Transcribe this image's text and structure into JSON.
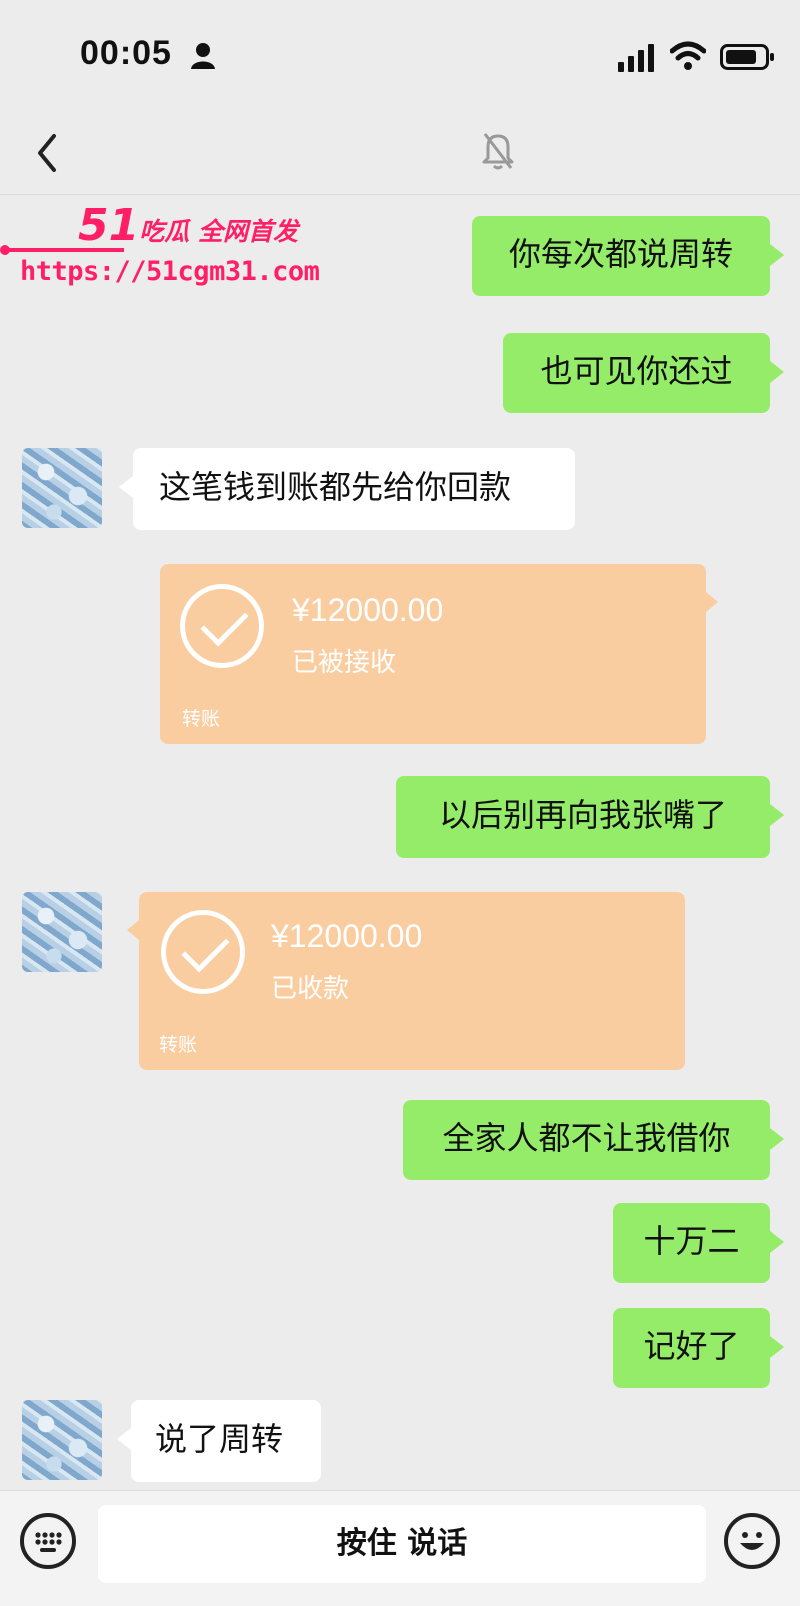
{
  "status_bar": {
    "time": "00:05"
  },
  "watermark": {
    "logo_number": "51",
    "logo_text": "吃瓜 全网首发",
    "url": "https://51cgm31.com"
  },
  "messages": [
    {
      "side": "right",
      "text": "你每次都说周转"
    },
    {
      "side": "right",
      "text": "也可见你还过"
    },
    {
      "side": "left",
      "text": "这笔钱到账都先给你回款"
    },
    {
      "side": "right",
      "type": "transfer",
      "amount": "¥12000.00",
      "status": "已被接收",
      "label": "转账"
    },
    {
      "side": "right",
      "text": "以后别再向我张嘴了"
    },
    {
      "side": "left",
      "type": "transfer",
      "amount": "¥12000.00",
      "status": "已收款",
      "label": "转账"
    },
    {
      "side": "right",
      "text": "全家人都不让我借你"
    },
    {
      "side": "right",
      "text": "十万二"
    },
    {
      "side": "right",
      "text": "记好了"
    },
    {
      "side": "left",
      "text": "说了周转"
    }
  ],
  "input_bar": {
    "hold_to_talk": "按住 说话"
  }
}
